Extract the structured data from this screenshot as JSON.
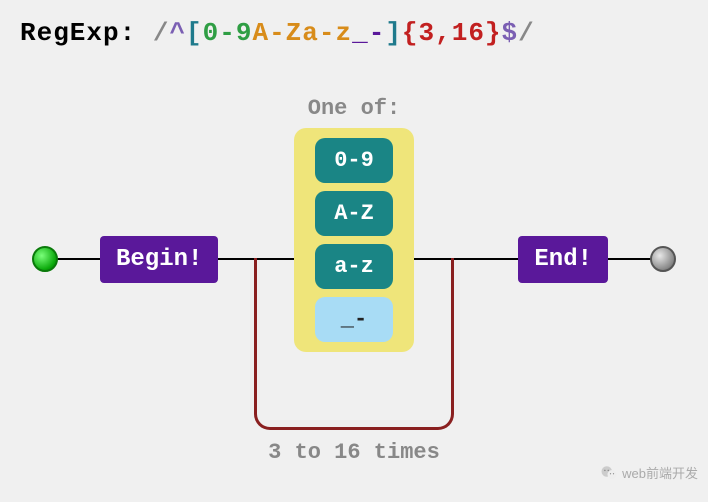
{
  "title_label": "RegExp:",
  "regex": {
    "slash_open": "/",
    "caret": "^",
    "bracket_open": "[",
    "range_digits": "0-9",
    "range_upper": "A-Z",
    "range_lower": "a-z",
    "literal": "_-",
    "bracket_close": "]",
    "quantifier": "{3,16}",
    "dollar": "$",
    "slash_close": "/"
  },
  "diagram": {
    "begin": "Begin!",
    "end": "End!",
    "one_of": "One of:",
    "ranges": [
      "0-9",
      "A-Z",
      "a-z"
    ],
    "literal": "_-",
    "loop_label": "3 to 16 times"
  },
  "watermark": "web前端开发"
}
